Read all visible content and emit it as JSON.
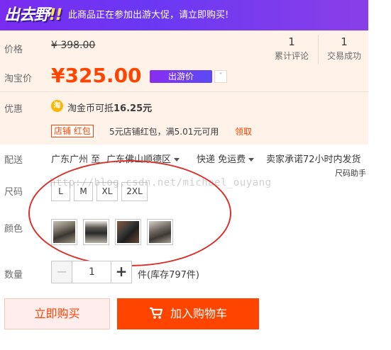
{
  "banner": {
    "logo_text": "出去野",
    "logo_mark": "!!",
    "message": "此商品正在参加出游大促，请立即购买!"
  },
  "price": {
    "orig_label": "价格",
    "orig_value": "¥ 398.00",
    "cur_label": "淘宝价",
    "cur_value": "¥325.00",
    "badge": "出游价",
    "badge_arrow": "˅"
  },
  "stats": {
    "reviews_count": "1",
    "reviews_label": "累计评论",
    "deals_count": "1",
    "deals_label": "交易成功"
  },
  "promo": {
    "label": "优惠",
    "coin_glyph": "淘",
    "coin_text_prefix": "淘金币可抵",
    "coin_amount": "16.25元",
    "shop_tag": "店铺 红包",
    "shop_text": "5元店铺红包，满5.01元可用",
    "shop_link": "领取"
  },
  "delivery": {
    "label": "配送",
    "from": "广东广州 至",
    "to": "广东佛山顺德区",
    "shipping": "快递 免运费",
    "promise": "卖家承诺72小时内发货"
  },
  "size": {
    "label": "尺码",
    "helper": "尺码助手",
    "options": [
      "L",
      "M",
      "XL",
      "2XL"
    ]
  },
  "color": {
    "label": "颜色"
  },
  "quantity": {
    "label": "数量",
    "minus": "−",
    "value": "1",
    "plus": "+",
    "stock": "件(库存797件)"
  },
  "actions": {
    "buy_now": "立即购买",
    "add_cart": "加入购物车"
  },
  "watermark": "http://blog.csdn.net/michael_ouyang",
  "colors": {
    "accent": "#ff4400",
    "banner": "#7a2cf0",
    "annotation": "#d8322a"
  }
}
